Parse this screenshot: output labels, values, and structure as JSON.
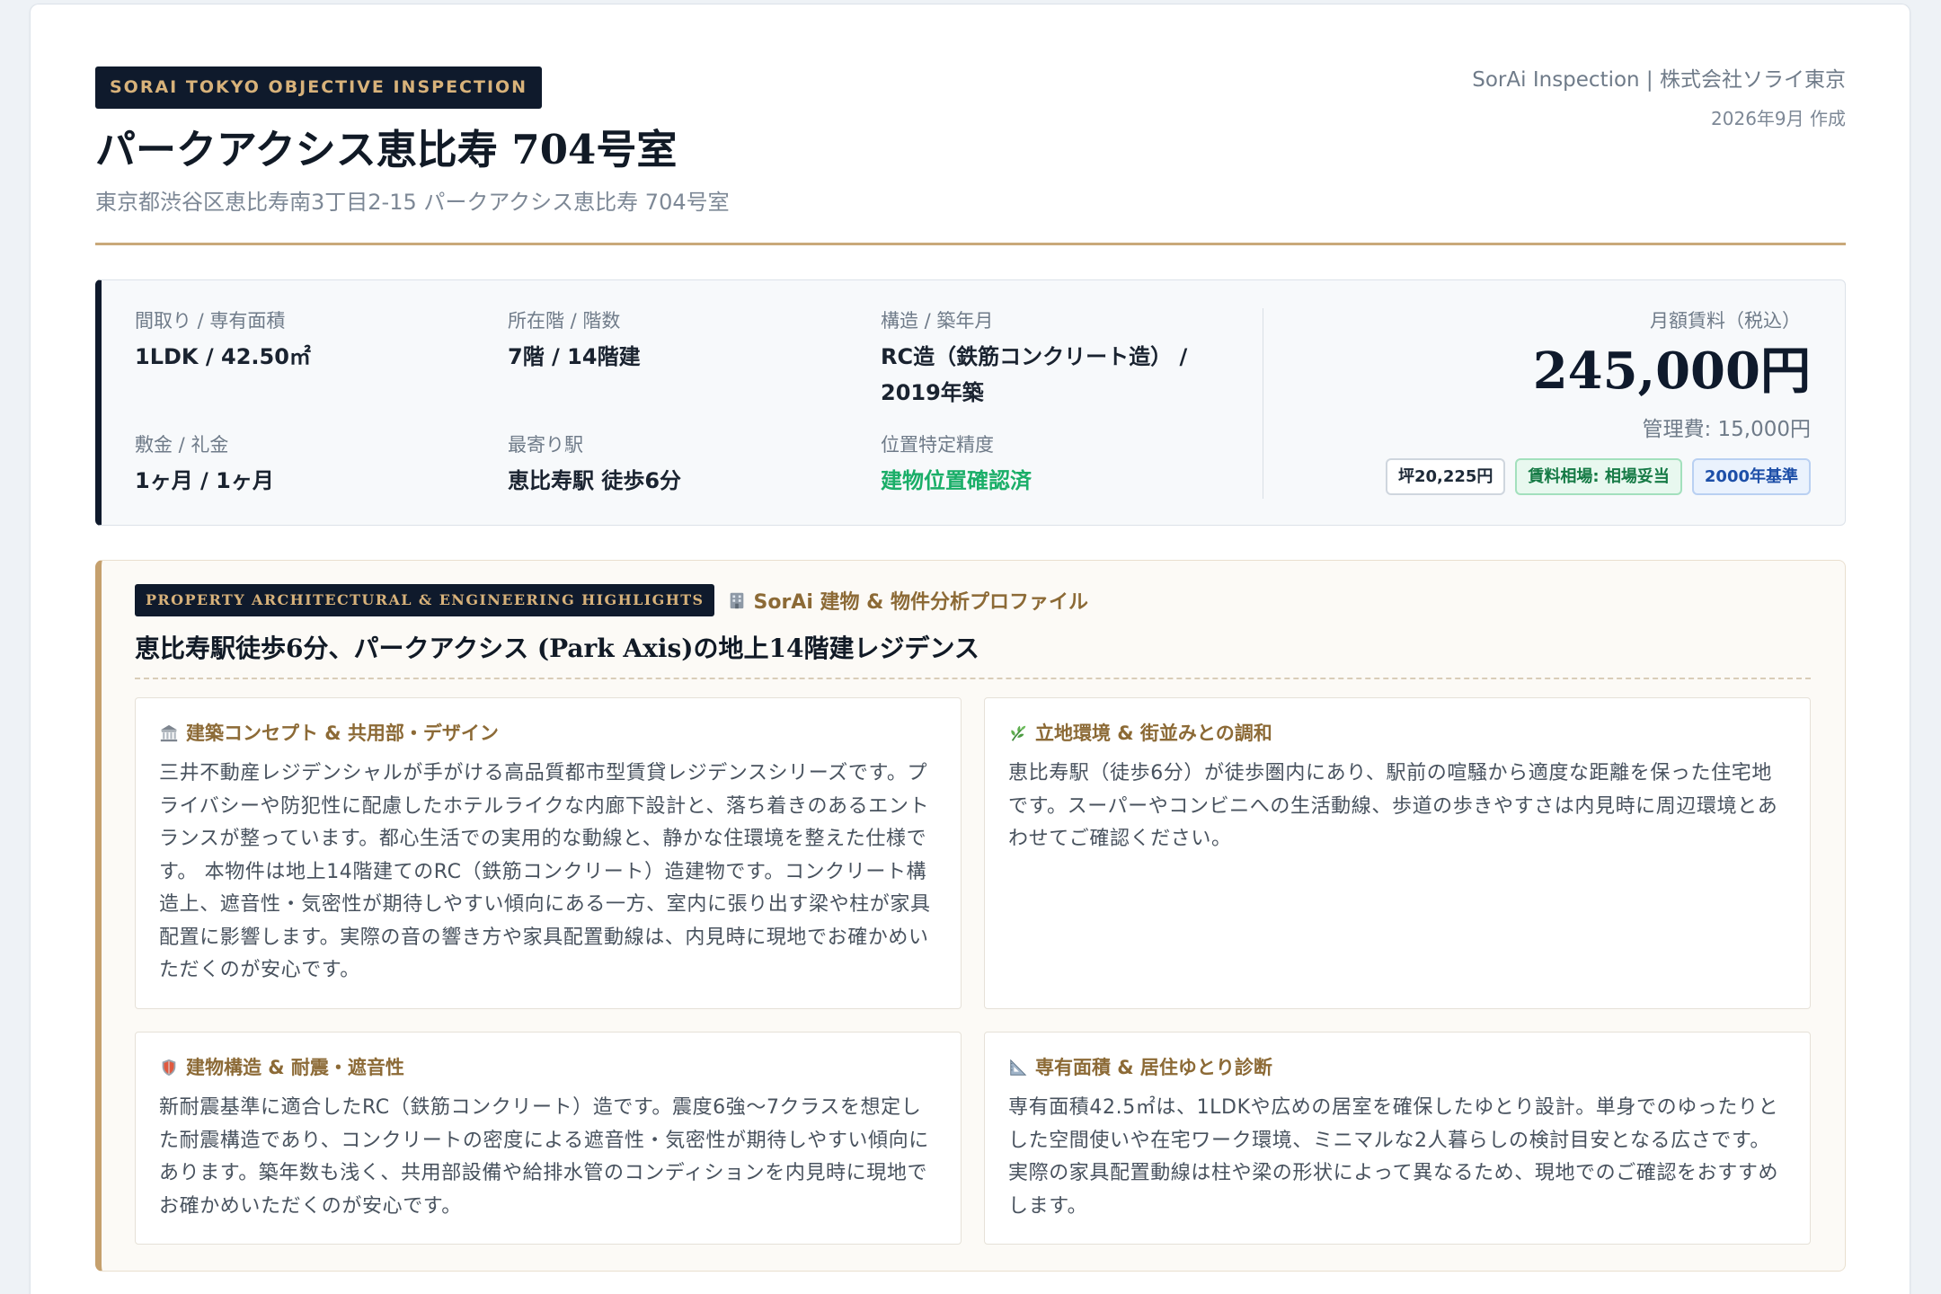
{
  "colors": {
    "navy": "#0f1a2c",
    "gold": "#c5a06d",
    "gold_text": "#d8b27a",
    "accent_text": "#8c6a36",
    "positive": "#1aae68"
  },
  "header": {
    "badge": "SORAI TOKYO OBJECTIVE INSPECTION",
    "title": "パークアクシス恵比寿 704号室",
    "address": "東京都渋谷区恵比寿南3丁目2-15 パークアクシス恵比寿 704号室",
    "company": "SorAi Inspection | 株式会社ソライ東京",
    "date": "2026年9月 作成"
  },
  "summary": {
    "fields": [
      {
        "label": "間取り / 専有面積",
        "value": "1LDK / 42.50㎡"
      },
      {
        "label": "所在階 / 階数",
        "value": "7階 / 14階建"
      },
      {
        "label": "構造 / 築年月",
        "value": "RC造（鉄筋コンクリート造） / 2019年築"
      },
      {
        "label": "敷金 / 礼金",
        "value": "1ヶ月 / 1ヶ月"
      },
      {
        "label": "最寄り駅",
        "value": "恵比寿駅 徒歩6分"
      },
      {
        "label": "位置特定精度",
        "value": "建物位置確認済"
      }
    ],
    "rent_label": "月額賃料（税込）",
    "rent": "245,000円",
    "management_fee": "管理費: 15,000円",
    "badges": [
      {
        "text": "坪20,225円"
      },
      {
        "text": "賃料相場: 相場妥当"
      },
      {
        "text": "2000年基準"
      }
    ]
  },
  "highlights": {
    "badge": "PROPERTY ARCHITECTURAL & ENGINEERING HIGHLIGHTS",
    "profile_icon": "building-icon",
    "profile_label": "SorAi 建物 & 物件分析プロファイル",
    "heading": "恵比寿駅徒歩6分、パークアクシス (Park Axis)の地上14階建レジデンス",
    "cards": [
      {
        "icon": "classical-building-icon",
        "title": "建築コンセプト & 共用部・デザイン",
        "body": "三井不動産レジデンシャルが手がける高品質都市型賃貸レジデンスシリーズです。プライバシーや防犯性に配慮したホテルライクな内廊下設計と、落ち着きのあるエントランスが整っています。都心生活での実用的な動線と、静かな住環境を整えた仕様です。 本物件は地上14階建てのRC（鉄筋コンクリート）造建物です。コンクリート構造上、遮音性・気密性が期待しやすい傾向にある一方、室内に張り出す梁や柱が家具配置に影響します。実際の音の響き方や家具配置動線は、内見時に現地でお確かめいただくのが安心です。"
      },
      {
        "icon": "leaf-icon",
        "title": "立地環境 & 街並みとの調和",
        "body": "恵比寿駅（徒歩6分）が徒歩圏内にあり、駅前の喧騒から適度な距離を保った住宅地です。スーパーやコンビニへの生活動線、歩道の歩きやすさは内見時に周辺環境とあわせてご確認ください。"
      },
      {
        "icon": "shield-icon",
        "title": "建物構造 & 耐震・遮音性",
        "body": "新耐震基準に適合したRC（鉄筋コンクリート）造です。震度6強〜7クラスを想定した耐震構造であり、コンクリートの密度による遮音性・気密性が期待しやすい傾向にあります。築年数も浅く、共用部設備や給排水管のコンディションを内見時に現地でお確かめいただくのが安心です。"
      },
      {
        "icon": "triangular-ruler-icon",
        "title": "専有面積 & 居住ゆとり診断",
        "body": "専有面積42.5㎡は、1LDKや広めの居室を確保したゆとり設計。単身でのゆったりとした空間使いや在宅ワーク環境、ミニマルな2人暮らしの検討目安となる広さです。実際の家具配置動線は柱や梁の形状によって異なるため、現地でのご確認をおすすめします。"
      }
    ]
  }
}
